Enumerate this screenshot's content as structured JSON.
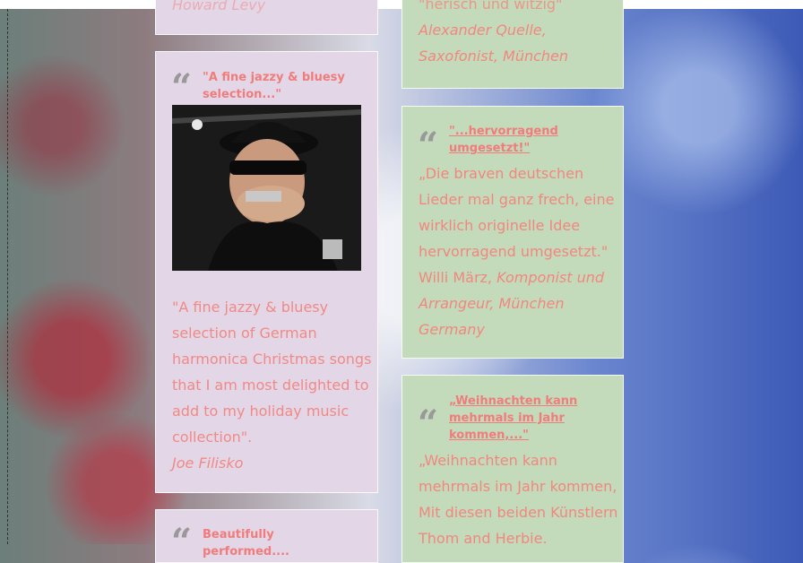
{
  "left_column": {
    "top_card_tail": "Howard Levy",
    "card_fine_jazzy": {
      "quote_icon": "quote-icon",
      "title": "\"A fine jazzy & bluesy selection...\"",
      "photo_alt": "Musician with hat and sunglasses playing harmonica",
      "quote_lines": [
        "\"A fine jazzy & bluesy",
        "selection of German",
        "harmonica Christmas songs",
        "that I am most delighted to",
        "add to my holiday music",
        "collection\"."
      ],
      "author": "Joe Filisko"
    },
    "card_beautifully": {
      "title": "Beautifully performed...."
    }
  },
  "right_column": {
    "top_card_tail": {
      "partial_line": "\"herisch und witzig\"",
      "author_line1": "Alexander Quelle,",
      "author_line2": "Saxofonist, München"
    },
    "card_hervorragend": {
      "title_line1": "\"...hervorragend",
      "title_line2": "umgesetzt!\"",
      "quote_lines": [
        "„Die braven deutschen",
        "Lieder mal ganz frech, eine",
        "wirklich originelle Idee",
        "hervorragend umgesetzt.\""
      ],
      "author_name": "Willi März, ",
      "author_role_line1": "Komponist und",
      "author_role_line2": "Arrangeur, München",
      "author_role_line3": "Germany"
    },
    "card_weihnachten": {
      "title_line1": "„Weihnachten kann",
      "title_line2": "mehrmals im Jahr",
      "title_line3": "kommen,...\"",
      "quote_lines": [
        "„Weihnachten kann",
        "mehrmals im Jahr kommen,",
        "Mit diesen beiden Künstlern",
        "Thom and Herbie."
      ]
    }
  }
}
